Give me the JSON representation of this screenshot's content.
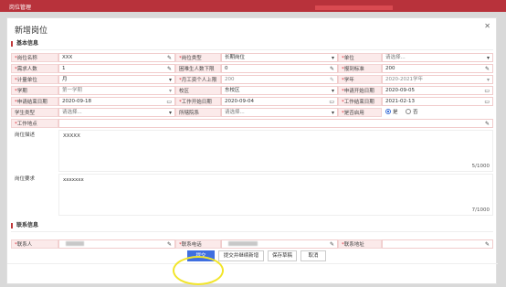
{
  "app": {
    "tab_title": "岗位管理"
  },
  "dialog": {
    "title": "新增岗位",
    "close_icon": "close-icon",
    "sections": {
      "basic": "基本信息",
      "contact": "联系信息"
    }
  },
  "form": {
    "post_name": {
      "label": "岗位名称",
      "value": "XXX"
    },
    "post_type": {
      "label": "岗位类型",
      "value": "长期岗位"
    },
    "unit": {
      "label": "单位",
      "placeholder": "请选择..."
    },
    "demand_count": {
      "label": "需求人数",
      "value": "1"
    },
    "min_students": {
      "label": "困难生人数下限",
      "value": "0"
    },
    "sign_quota": {
      "label": "报到标准",
      "value": "200"
    },
    "calc_unit": {
      "label": "计量单位",
      "value": "月"
    },
    "monthly_cap": {
      "label": "月工资个人上限",
      "value": "200"
    },
    "school_year": {
      "label": "学年",
      "value": "2020-2021学年"
    },
    "semester": {
      "label": "学期",
      "value": "第一学期"
    },
    "campus": {
      "label": "校区",
      "value": "东校区"
    },
    "apply_start": {
      "label": "申请开始日期",
      "value": "2020-09-05"
    },
    "apply_end": {
      "label": "申请结束日期",
      "value": "2020-09-18"
    },
    "work_start": {
      "label": "工作开始日期",
      "value": "2020-09-04"
    },
    "work_end": {
      "label": "工作结束日期",
      "value": "2021-02-13"
    },
    "student_type": {
      "label": "学生类型",
      "placeholder": "请选择..."
    },
    "dept": {
      "label": "所辖院系",
      "placeholder": "请选择..."
    },
    "enabled": {
      "label": "是否启用",
      "options": [
        "是",
        "否"
      ],
      "selected": "是"
    },
    "location": {
      "label": "工作地点",
      "value": ""
    },
    "description": {
      "label": "岗位描述",
      "value": "XXXXX",
      "count": "5/1000"
    },
    "requirement": {
      "label": "岗位要求",
      "value": "xxxxxxx",
      "count": "7/1000"
    },
    "contact_person": {
      "label": "联系人"
    },
    "contact_phone": {
      "label": "联系电话"
    },
    "contact_address": {
      "label": "联系地址",
      "value": ""
    }
  },
  "buttons": {
    "submit": "提交",
    "submit_continue": "提交并继续新增",
    "save_draft": "保存草稿",
    "cancel": "取消"
  },
  "icons": {
    "edit": "✎",
    "dropdown": "▾",
    "calendar": "▭",
    "close": "✕"
  },
  "colors": {
    "accent": "#b8323b",
    "primary": "#3f6fe0",
    "required": "#d9333d",
    "highlight": "#f2e52a"
  }
}
